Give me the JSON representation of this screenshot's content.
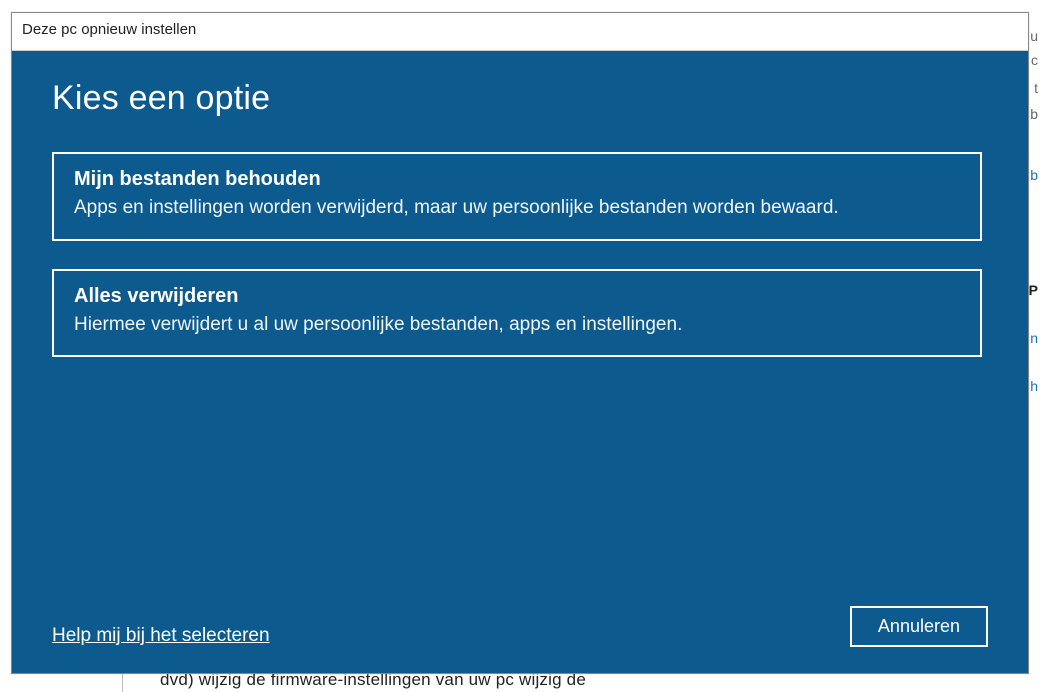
{
  "window": {
    "title": "Deze pc opnieuw instellen"
  },
  "heading": "Kies een optie",
  "options": [
    {
      "title": "Mijn bestanden behouden",
      "desc": "Apps en instellingen worden verwijderd, maar uw persoonlijke bestanden worden bewaard."
    },
    {
      "title": "Alles verwijderen",
      "desc": "Hiermee verwijdert u al uw persoonlijke bestanden, apps en instellingen."
    }
  ],
  "footer": {
    "help_link": "Help mij bij het selecteren",
    "cancel_label": "Annuleren"
  },
  "background": {
    "truncated_text": "dvd)  wijzig de firmware-instellingen van uw pc  wijzig de",
    "right_letters": [
      "u",
      "c",
      "t",
      "b",
      "b",
      "P",
      "n",
      "h"
    ]
  }
}
